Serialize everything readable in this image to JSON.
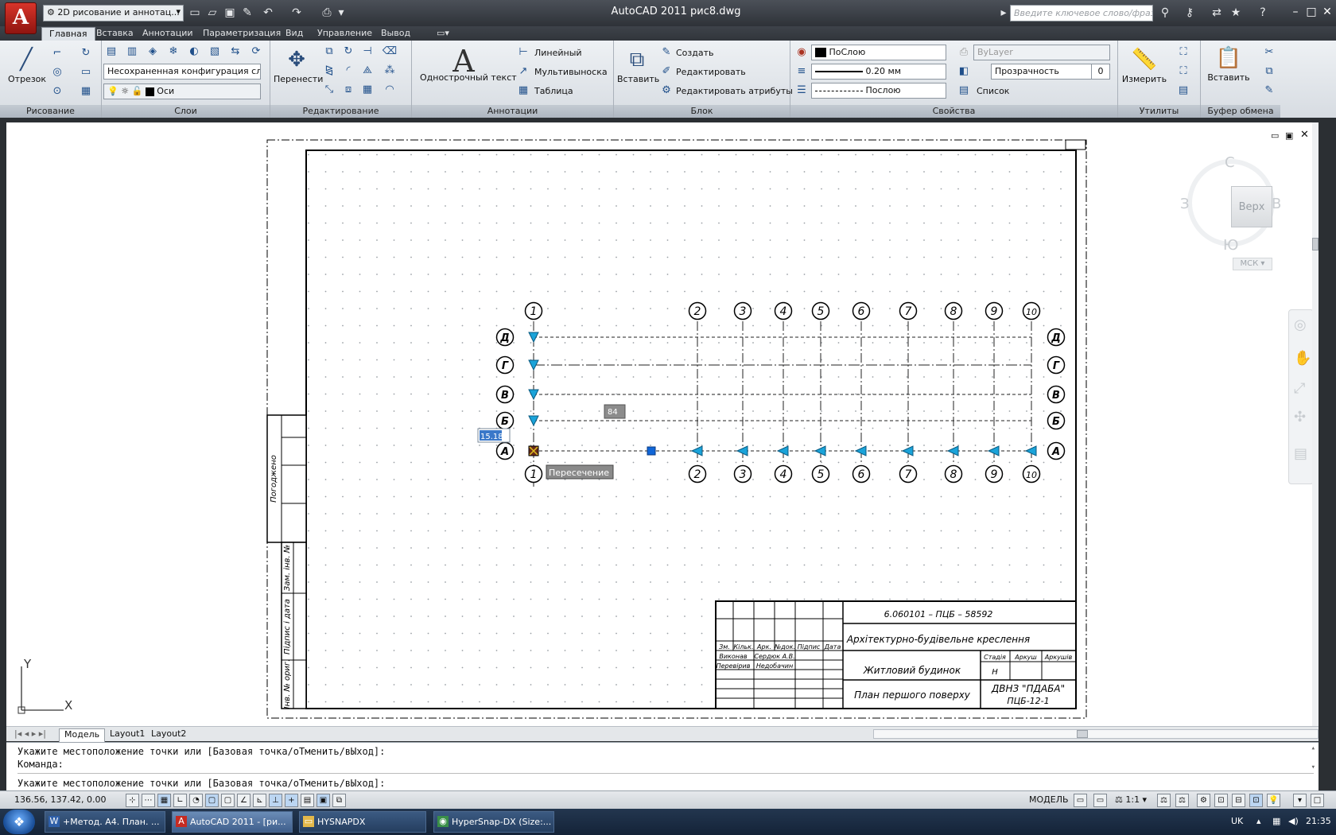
{
  "app": {
    "logo_letter": "A",
    "title": "AutoCAD 2011    рис8.dwg",
    "workspace": "2D рисование и аннотац...",
    "search_placeholder": "Введите ключевое слово/фразу"
  },
  "tabs": [
    "Главная",
    "Вставка",
    "Аннотации",
    "Параметризация",
    "Вид",
    "Управление",
    "Вывод"
  ],
  "ribbon": {
    "draw": {
      "title": "Рисование",
      "line": "Отрезок"
    },
    "layers": {
      "title": "Слои",
      "layer_state": "Несохраненная конфигурация слоев",
      "current_layer": "Оси"
    },
    "modify": {
      "title": "Редактирование",
      "move": "Перенести"
    },
    "annotation": {
      "title": "Аннотации",
      "single_text": "Однострочный текст",
      "linear": "Линейный",
      "multileader": "Мультивыноска",
      "table": "Таблица"
    },
    "block": {
      "title": "Блок",
      "insert": "Вставить",
      "create": "Создать",
      "edit": "Редактировать",
      "edit_attributes": "Редактировать атрибуты"
    },
    "properties": {
      "title": "Свойства",
      "color": "ПоСлою",
      "lineweight": "0.20 мм",
      "linetype": "Послою",
      "plotstyle": "ByLayer",
      "transparency_label": "Прозрачность",
      "transparency_value": "0",
      "list": "Список"
    },
    "utilities": {
      "title": "Утилиты",
      "measure": "Измерить"
    },
    "clipboard": {
      "title": "Буфер обмена",
      "paste": "Вставить"
    }
  },
  "viewcube": {
    "north": "С",
    "south": "Ю",
    "west": "З",
    "east": "В",
    "face": "Верх",
    "ucs": "МСК"
  },
  "drawing": {
    "column_axes": [
      "1",
      "2",
      "3",
      "4",
      "5",
      "6",
      "7",
      "8",
      "9",
      "10"
    ],
    "row_axes": [
      "Д",
      "Г",
      "В",
      "Б",
      "А"
    ],
    "dim_input": "15.18",
    "dim_value": "84",
    "osnap_tooltip": "Пересечение",
    "side_stamp": [
      "Погоджено",
      "Зам. інв. №",
      "Підпис і дата",
      "Інв. № ориг."
    ],
    "title_block": {
      "code": "6.060101 – ПЦБ – 58592",
      "subject": "Архітектурно-будівельне креслення",
      "object": "Житловий будинок",
      "sheet_title": "План першого поверху",
      "org_line1": "ДВНЗ \"ПДАБА\"",
      "org_line2": "ПЦБ-12-1",
      "col_headers": [
        "Зм.",
        "Кільк.",
        "Арк.",
        "№док.",
        "Підпис",
        "Дата"
      ],
      "roles": [
        "Виконав",
        "Перевірив"
      ],
      "names": [
        "Сердюк А.В.",
        "Недобачин"
      ],
      "stage_headers": [
        "Стадія",
        "Аркуш",
        "Аркушів"
      ],
      "stage": "Н"
    },
    "ucs_x": "X",
    "ucs_y": "Y"
  },
  "layout_tabs": [
    "Модель",
    "Layout1",
    "Layout2"
  ],
  "command_line": [
    "Укажите местоположение точки или [Базовая точка/оТменить/вЫход]:",
    "Команда:",
    "Укажите местоположение точки или [Базовая точка/оТменить/вЫход]:"
  ],
  "status": {
    "coords": "136.56, 137.42, 0.00",
    "model": "МОДЕЛЬ",
    "scale": "1:1"
  },
  "taskbar": {
    "items": [
      "+Метод. А4. План. ...",
      "AutoCAD 2011 - [ри...",
      "HYSNAPDX",
      "HyperSnap-DX (Size:..."
    ],
    "lang": "UK",
    "clock": "21:35"
  }
}
